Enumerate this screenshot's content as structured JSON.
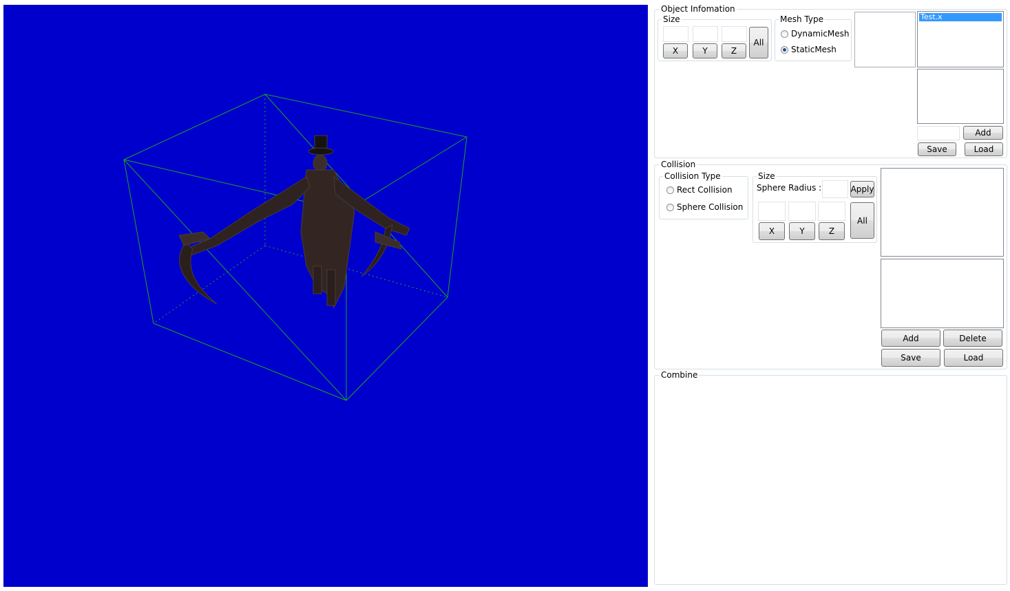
{
  "object_info": {
    "title": "Object Infomation",
    "size": {
      "title": "Size",
      "x_label": "X",
      "y_label": "Y",
      "z_label": "Z",
      "all_label": "All"
    },
    "mesh_type": {
      "title": "Mesh Type",
      "options": [
        "DynamicMesh",
        "StaticMesh"
      ],
      "selected": "StaticMesh"
    },
    "file_list": {
      "items": [
        "Test.x"
      ],
      "selected": "Test.x"
    },
    "add_label": "Add",
    "save_label": "Save",
    "load_label": "Load"
  },
  "collision": {
    "title": "Collision",
    "type": {
      "title": "Collision Type",
      "options": [
        "Rect Collision",
        "Sphere Collision"
      ]
    },
    "size": {
      "title": "Size",
      "sphere_radius_label": "Sphere Radius :",
      "apply_label": "Apply",
      "x_label": "X",
      "y_label": "Y",
      "z_label": "Z",
      "all_label": "All"
    },
    "add_label": "Add",
    "delete_label": "Delete",
    "save_label": "Save",
    "load_label": "Load"
  },
  "combine": {
    "title": "Combine"
  },
  "colors": {
    "viewport_bg": "#0000cc",
    "bbox_line": "#1fa21f",
    "selection": "#3399ff"
  }
}
